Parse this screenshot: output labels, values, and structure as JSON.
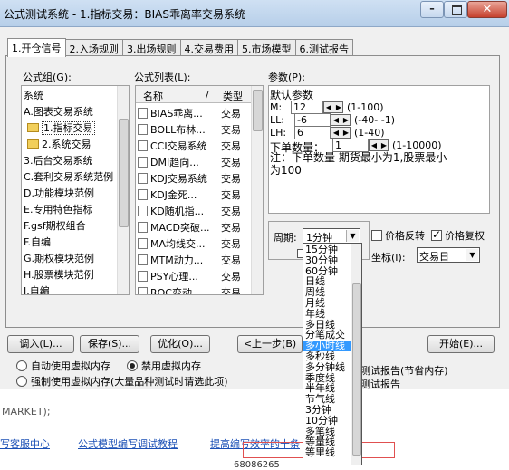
{
  "window": {
    "title": "公式测试系统 - 1.指标交易：BIAS乖离率交易系统"
  },
  "tabs": [
    "1.开仓信号",
    "2.入场规则",
    "3.出场规则",
    "4.交易费用",
    "5.市场模型",
    "6.测试报告"
  ],
  "formula_group": {
    "label": "公式组(G):",
    "items": [
      "系统",
      "A.图表交易系统",
      "1.指标交易",
      "2.系统交易",
      "3.后台交易系统",
      "C.套利交易系统范例",
      "D.功能模块范例",
      "E.专用特色指标",
      "F.gsf期权组合",
      "F.自编",
      "G.期权模块范例",
      "H.股票模块范例",
      "I.自编"
    ]
  },
  "formula_list": {
    "label": "公式列表(L):",
    "col_name": "名称",
    "col_sep": "/",
    "col_type": "类型",
    "rows": [
      {
        "name": "BIAS乖离...",
        "type": "交易"
      },
      {
        "name": "BOLL布林...",
        "type": "交易"
      },
      {
        "name": "CCI交易系统",
        "type": "交易"
      },
      {
        "name": "DMI趋向...",
        "type": "交易"
      },
      {
        "name": "KDJ交易系统",
        "type": "交易"
      },
      {
        "name": "KDJ金死...",
        "type": "交易"
      },
      {
        "name": "KD随机指...",
        "type": "交易"
      },
      {
        "name": "MACD突破...",
        "type": "交易"
      },
      {
        "name": "MA均线交...",
        "type": "交易"
      },
      {
        "name": "MTM动力...",
        "type": "交易"
      },
      {
        "name": "PSY心理...",
        "type": "交易"
      },
      {
        "name": "ROC变动...",
        "type": "交易"
      }
    ]
  },
  "params": {
    "label": "参数(P):",
    "default_label": "默认参数",
    "rows": [
      {
        "name": "M:",
        "value": "12",
        "range": "(1-100)"
      },
      {
        "name": "LL:",
        "value": "-6",
        "range": "(-40- -1)"
      },
      {
        "name": "LH:",
        "value": "6",
        "range": "(1-40)"
      }
    ],
    "qty_label": "下单数量：",
    "qty_value": "1",
    "qty_range": "(1-10000)",
    "note": "注：下单数量 期货最小为1,股票最小为100"
  },
  "period": {
    "label": "周期:",
    "value": "1分钟"
  },
  "price_reverse": {
    "label": "价格反转",
    "checked": false
  },
  "price_restore": {
    "label": "价格复权",
    "checked": true
  },
  "coord": {
    "label": "坐标(I):",
    "value": "交易日"
  },
  "period_options": [
    "15分钟",
    "30分钟",
    "60分钟",
    "日线",
    "周线",
    "月线",
    "年线",
    "多日线",
    "分笔成交",
    "多小时线",
    "多秒线",
    "多分钟线",
    "季度线",
    "半年线",
    "节气线",
    "3分钟",
    "10分钟",
    "多笔线",
    "等量线",
    "等里线"
  ],
  "period_selected_index": 9,
  "buttons": {
    "import": "调入(L)...",
    "save": "保存(S)...",
    "optimize": "优化(O)...",
    "prev": "<上一步(B)",
    "next": "下一步(N)>",
    "start": "开始(E)..."
  },
  "memory": {
    "auto": "自动使用虚拟内存",
    "disable": "禁用虚拟内存",
    "force": "强制使用虚拟内存(大量品种测试时请选此项)",
    "selected": "disable"
  },
  "report_opts": {
    "opt1": "测试报告(节省内存)",
    "opt2": "测试报告"
  },
  "bg": {
    "code_line": "MARKET);",
    "links": [
      "写客服中心",
      "公式模型编写调试教程",
      "提高编写效率的十条"
    ],
    "status_num": "68086265"
  }
}
